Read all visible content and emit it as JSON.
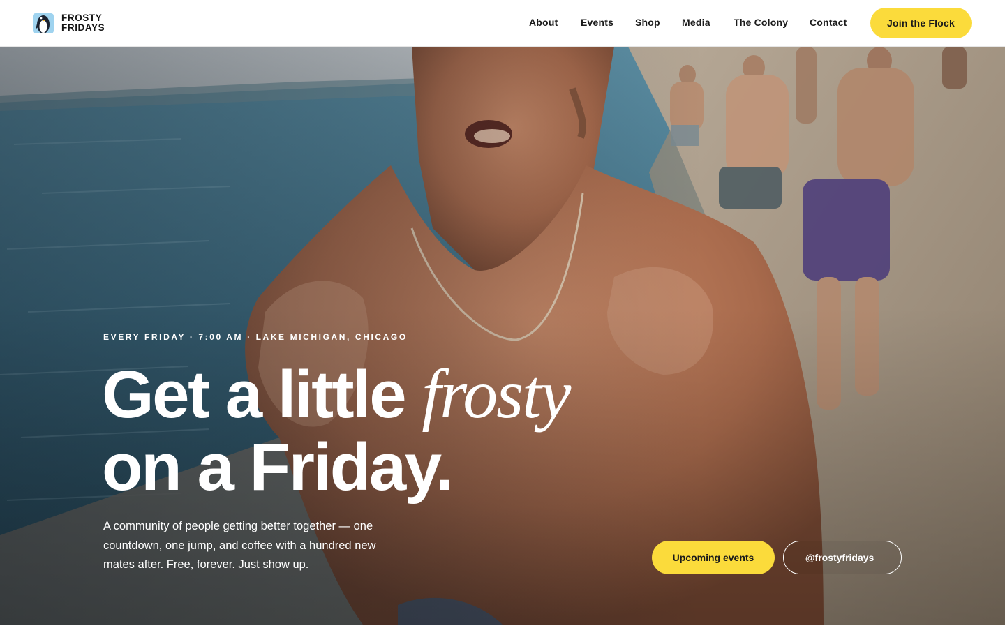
{
  "brand": {
    "name_line1": "FROSTY",
    "name_line2": "FRIDAYS",
    "logo_icon": "penguin-icon",
    "accent_color": "#fbdb3b"
  },
  "nav": {
    "items": [
      {
        "label": "About"
      },
      {
        "label": "Events"
      },
      {
        "label": "Shop"
      },
      {
        "label": "Media"
      },
      {
        "label": "The Colony"
      },
      {
        "label": "Contact"
      }
    ],
    "cta_label": "Join the Flock"
  },
  "hero": {
    "eyebrow": "EVERY FRIDAY · 7:00 AM · LAKE MICHIGAN, CHICAGO",
    "headline_part1": "Get a little ",
    "headline_emphasis": "frosty",
    "headline_line2": "on a Friday.",
    "subcopy": "A community of people getting better together — one countdown, one jump, and coffee with a hundred new mates after. Free, forever. Just show up.",
    "primary_button": "Upcoming events",
    "secondary_button": "@frostyfridays_",
    "background_image": "photo-of-swimmers-on-lakefront"
  }
}
